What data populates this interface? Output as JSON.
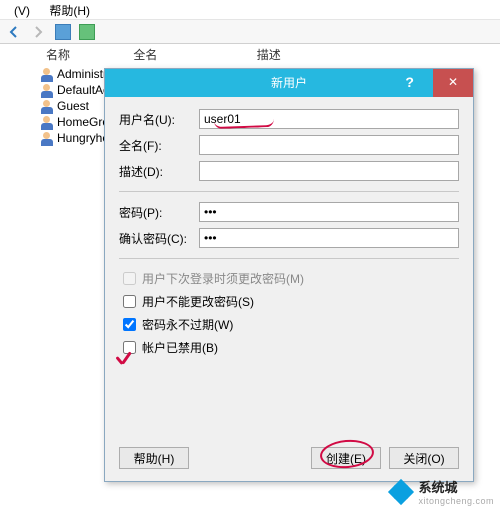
{
  "menu": {
    "view": "(V)",
    "help": "帮助(H)"
  },
  "columns": {
    "name": "名称",
    "fullname": "全名",
    "description": "描述"
  },
  "users": [
    "Administr",
    "DefaultAc",
    "Guest",
    "HomeGro",
    "Hungryhe"
  ],
  "dialog": {
    "title": "新用户",
    "help": "?",
    "close": "✕",
    "labels": {
      "username": "用户名(U):",
      "fullname": "全名(F):",
      "description": "描述(D):",
      "password": "密码(P):",
      "confirm": "确认密码(C):"
    },
    "values": {
      "username": "user01",
      "fullname": "",
      "description": "",
      "password": "•••",
      "confirm": "•••"
    },
    "checkboxes": {
      "must_change": "用户下次登录时须更改密码(M)",
      "cannot_change": "用户不能更改密码(S)",
      "never_expires": "密码永不过期(W)",
      "disabled": "帐户已禁用(B)"
    },
    "buttons": {
      "help": "帮助(H)",
      "create": "创建(E)",
      "close": "关闭(O)"
    }
  },
  "watermark": {
    "brand": "系统城",
    "url": "xitongcheng.com"
  }
}
